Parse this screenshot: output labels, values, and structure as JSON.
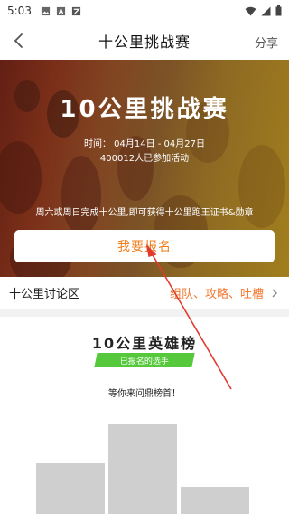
{
  "status_bar": {
    "time": "5:03",
    "left_icons": [
      "image-icon",
      "a-badge-icon",
      "app-icon"
    ],
    "right_icons": [
      "wifi-icon",
      "signal-icon",
      "battery-icon"
    ]
  },
  "nav": {
    "back_icon": "back-arrow-icon",
    "title": "十公里挑战赛",
    "share_label": "分享"
  },
  "hero": {
    "title": "10公里挑战赛",
    "time": "时间：  04月14日 - 04月27日",
    "participants": "400012人已参加活动",
    "description": "周六或周日完成十公里,即可获得十公里跑王证书&勋章",
    "signup_label": "我要报名"
  },
  "discussion": {
    "title": "十公里讨论区",
    "tags": "组队、攻略、吐槽",
    "chevron_icon": "chevron-right-icon"
  },
  "leaderboard": {
    "title": "10公里英雄榜",
    "badge": "已报名的选手",
    "subtitle": "等你来问鼎榜首！",
    "podium_order": [
      "2nd",
      "1st",
      "3rd"
    ]
  },
  "colors": {
    "accent_orange": "#ef7d1a",
    "tag_orange": "#f27a33",
    "badge_green": "#55c93b",
    "podium_gray": "#cfcfcf",
    "annotation_red": "#e23b2e"
  }
}
